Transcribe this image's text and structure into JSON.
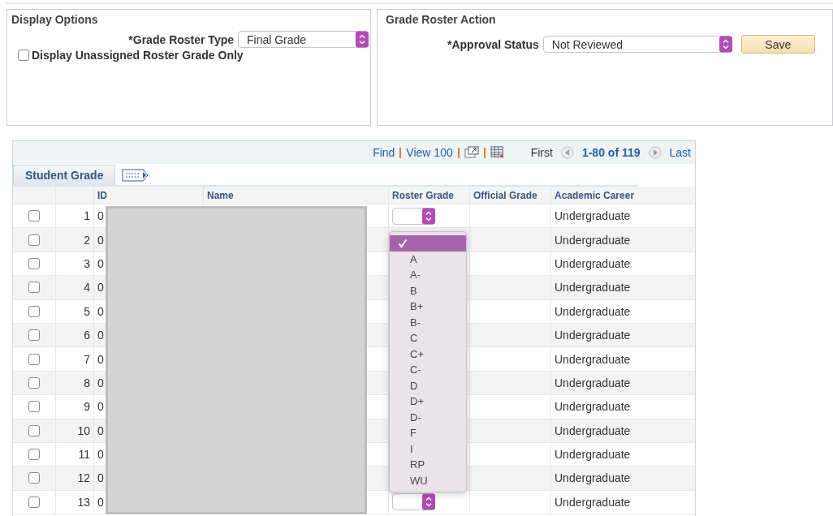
{
  "display_options": {
    "title": "Display Options",
    "grade_roster_type": {
      "label": "*Grade Roster Type",
      "value": "Final Grade"
    },
    "unassigned_only": {
      "label": "Display Unassigned Roster Grade Only",
      "checked": false
    }
  },
  "grade_roster_action": {
    "title": "Grade Roster Action",
    "approval_status": {
      "label": "*Approval Status",
      "value": "Not Reviewed"
    },
    "save_button": "Save"
  },
  "grid": {
    "find": "Find",
    "view_all": "View 100",
    "first": "First",
    "range": "1-80 of 119",
    "last": "Last",
    "tabs": [
      {
        "label": "Student Grade",
        "selected": true
      }
    ],
    "columns": [
      "ID",
      "Name",
      "Roster Grade",
      "Official Grade",
      "Academic Career"
    ],
    "rows": [
      {
        "number": "1",
        "id": "0",
        "checked": false,
        "grade_select": true,
        "academic_career": "Undergraduate"
      },
      {
        "number": "2",
        "id": "0",
        "checked": false,
        "grade_select": false,
        "academic_career": "Undergraduate"
      },
      {
        "number": "3",
        "id": "0",
        "checked": false,
        "grade_select": false,
        "academic_career": "Undergraduate"
      },
      {
        "number": "4",
        "id": "0",
        "checked": false,
        "grade_select": false,
        "academic_career": "Undergraduate"
      },
      {
        "number": "5",
        "id": "0",
        "checked": false,
        "grade_select": false,
        "academic_career": "Undergraduate"
      },
      {
        "number": "6",
        "id": "0",
        "checked": false,
        "grade_select": false,
        "academic_career": "Undergraduate"
      },
      {
        "number": "7",
        "id": "0",
        "checked": false,
        "grade_select": false,
        "academic_career": "Undergraduate"
      },
      {
        "number": "8",
        "id": "0",
        "checked": false,
        "grade_select": false,
        "academic_career": "Undergraduate"
      },
      {
        "number": "9",
        "id": "0",
        "checked": false,
        "grade_select": false,
        "academic_career": "Undergraduate"
      },
      {
        "number": "10",
        "id": "0",
        "checked": false,
        "grade_select": false,
        "academic_career": "Undergraduate"
      },
      {
        "number": "11",
        "id": "0",
        "checked": false,
        "grade_select": false,
        "academic_career": "Undergraduate"
      },
      {
        "number": "12",
        "id": "0",
        "checked": false,
        "grade_select": false,
        "academic_career": "Undergraduate"
      },
      {
        "number": "13",
        "id": "0",
        "checked": false,
        "grade_select": true,
        "academic_career": "Undergraduate"
      }
    ],
    "grade_menu": [
      {
        "selected": true
      },
      {
        "label": "A",
        "selected": false
      },
      {
        "label": "A-",
        "selected": false
      },
      {
        "label": "B",
        "selected": false
      },
      {
        "label": "B+",
        "selected": false
      },
      {
        "label": "B-",
        "selected": false
      },
      {
        "label": "C",
        "selected": false
      },
      {
        "label": "C+",
        "selected": false
      },
      {
        "label": "C-",
        "selected": false
      },
      {
        "label": "D",
        "selected": false
      },
      {
        "label": "D+",
        "selected": false
      },
      {
        "label": "D-",
        "selected": false
      },
      {
        "label": "F",
        "selected": false
      },
      {
        "label": "I",
        "selected": false
      },
      {
        "label": "RP",
        "selected": false
      },
      {
        "label": "WU",
        "selected": false
      }
    ]
  }
}
